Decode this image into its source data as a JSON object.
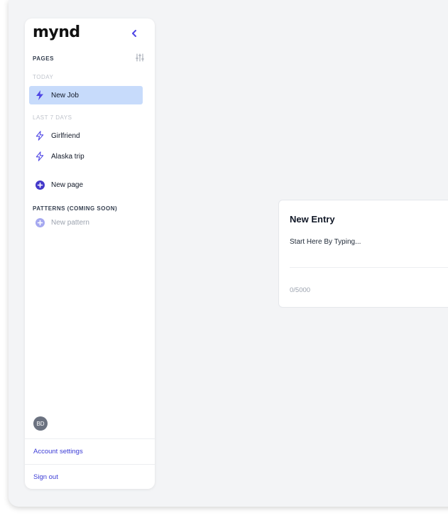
{
  "app": {
    "logo_text": "mynd"
  },
  "sidebar": {
    "pages_label": "PAGES",
    "today_label": "TODAY",
    "today_items": [
      {
        "label": "New Job",
        "icon": "bolt-filled-icon",
        "active": true
      }
    ],
    "last7_label": "LAST 7 DAYS",
    "last7_items": [
      {
        "label": "Girlfriend",
        "icon": "bolt-outline-icon"
      },
      {
        "label": "Alaska trip",
        "icon": "bolt-outline-icon"
      }
    ],
    "new_page_label": "New page",
    "patterns_label": "PATTERNS (COMING SOON)",
    "new_pattern_label": "New pattern",
    "avatar_initials": "BD",
    "account_settings_label": "Account settings",
    "sign_out_label": "Sign out"
  },
  "entry": {
    "title": "New Entry",
    "placeholder": "Start Here By Typing...",
    "counter": "0/5000"
  },
  "colors": {
    "accent": "#4f46e5",
    "active_item_bg": "#c7dbfb",
    "link": "#3b3bd6",
    "background": "#f3f4f6",
    "muted": "#9ca3af"
  }
}
